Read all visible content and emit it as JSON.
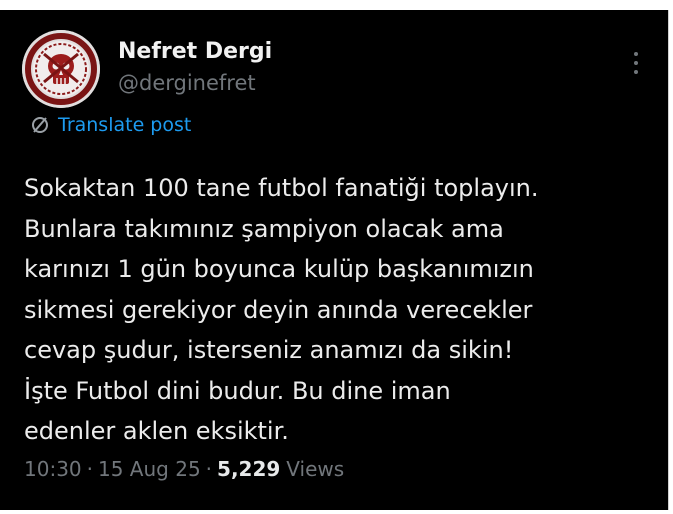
{
  "author": {
    "display_name": "Nefret Dergi",
    "handle": "@derginefret",
    "avatar_icon": "skull-logo-avatar"
  },
  "more_icon": "more-options-icon",
  "translate": {
    "icon": "translate-icon",
    "label": "Translate post",
    "color": "#1d9bf0"
  },
  "post": {
    "lines": [
      "Sokaktan 100 tane futbol fanatiği toplayın.",
      "Bunlara takımınız şampiyon olacak ama",
      "karınızı 1 gün boyunca kulüp başkanımızın",
      "sikmesi gerekiyor deyin anında verecekler",
      "cevap şudur, isterseniz anamızı da sikin!",
      "İşte Futbol dini budur. Bu dine iman",
      "edenler aklen eksiktir."
    ]
  },
  "meta": {
    "time": "10:30",
    "separator": "·",
    "date": "15 Aug 25",
    "views_count": "5,229",
    "views_label": "Views"
  },
  "colors": {
    "background": "#000000",
    "text": "#e7e9ea",
    "muted": "#71767b"
  }
}
